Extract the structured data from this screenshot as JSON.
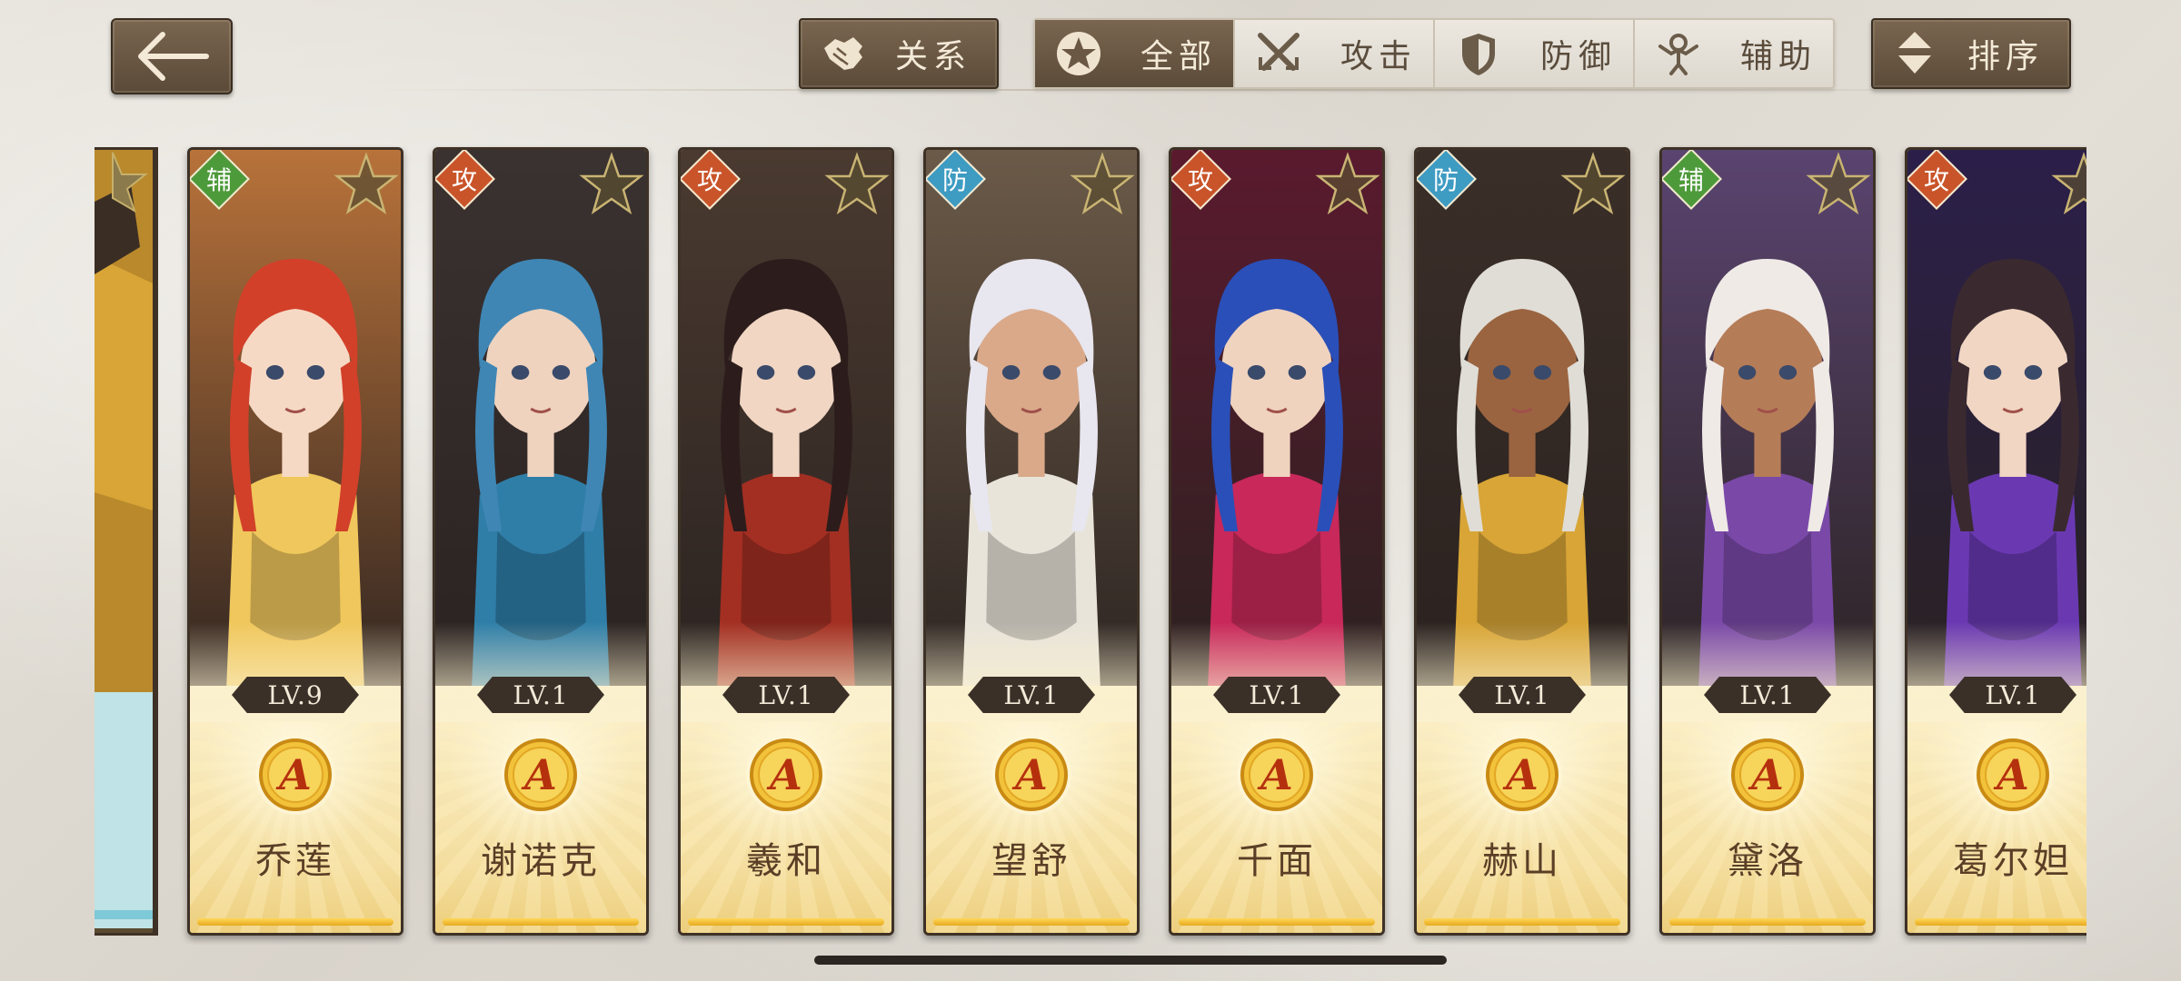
{
  "top_bar": {
    "relation_label": "关系",
    "sort_label": "排序",
    "filters": [
      {
        "label": "全部",
        "icon": "star-circle-icon",
        "active": true
      },
      {
        "label": "攻击",
        "icon": "crossed-swords-icon",
        "active": false
      },
      {
        "label": "防御",
        "icon": "shield-icon",
        "active": false
      },
      {
        "label": "辅助",
        "icon": "support-figure-icon",
        "active": false
      }
    ]
  },
  "role_colors": {
    "攻": "#c9542a",
    "防": "#3e9bc2",
    "辅": "#4d9a3a"
  },
  "heroes": [
    {
      "name": "乔莲",
      "level": "LV.9",
      "role": "辅",
      "rank": "A",
      "hair": "#d2402a",
      "bg": "#b8723a",
      "outfit": "#f0c75c",
      "skin": "#f6d9c4"
    },
    {
      "name": "谢诺克",
      "level": "LV.1",
      "role": "攻",
      "rank": "A",
      "hair": "#3f86b5",
      "bg": "#3a3230",
      "outfit": "#2f7ea8",
      "skin": "#efd3bf"
    },
    {
      "name": "羲和",
      "level": "LV.1",
      "role": "攻",
      "rank": "A",
      "hair": "#2c1d1c",
      "bg": "#4a3a30",
      "outfit": "#a32f22",
      "skin": "#f1d6c3"
    },
    {
      "name": "望舒",
      "level": "LV.1",
      "role": "防",
      "rank": "A",
      "hair": "#e8e6ee",
      "bg": "#6b5a48",
      "outfit": "#e9e4da",
      "skin": "#d9a98a"
    },
    {
      "name": "千面",
      "level": "LV.1",
      "role": "攻",
      "rank": "A",
      "hair": "#2a4fb8",
      "bg": "#5a1a2e",
      "outfit": "#c8285a",
      "skin": "#efd3bf"
    },
    {
      "name": "赫山",
      "level": "LV.1",
      "role": "防",
      "rank": "A",
      "hair": "#e0ddd6",
      "bg": "#3a2e28",
      "outfit": "#d8a536",
      "skin": "#9a6440"
    },
    {
      "name": "黛洛",
      "level": "LV.1",
      "role": "辅",
      "rank": "A",
      "hair": "#efeae6",
      "bg": "#5a4470",
      "outfit": "#7a49a8",
      "skin": "#b57c58"
    },
    {
      "name": "葛尔妲",
      "level": "LV.1",
      "role": "攻",
      "rank": "A",
      "hair": "#3a2a30",
      "bg": "#2b1f4a",
      "outfit": "#6a39b2",
      "skin": "#f1d6c3"
    }
  ]
}
